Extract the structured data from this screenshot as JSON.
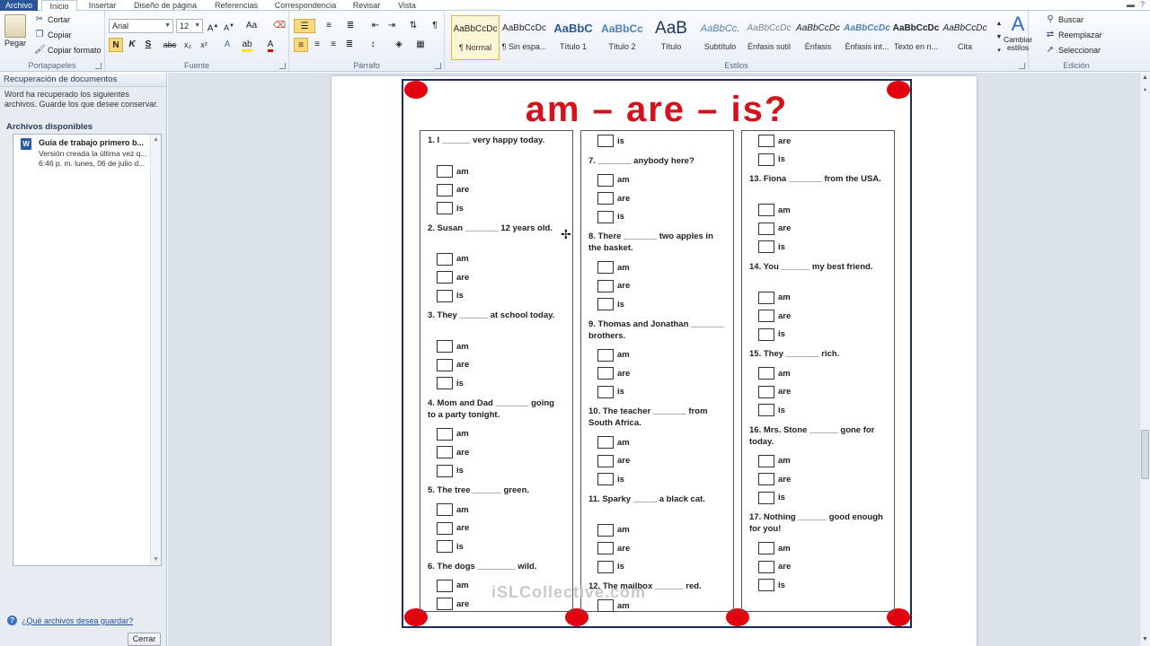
{
  "tabs": [
    "Archivo",
    "Inicio",
    "Insertar",
    "Diseño de página",
    "Referencias",
    "Correspondencia",
    "Revisar",
    "Vista"
  ],
  "clipboard": {
    "paste": "Pegar",
    "cut": "Cortar",
    "copy": "Copiar",
    "format": "Copiar formato",
    "label": "Portapapeles"
  },
  "font": {
    "name": "Arial",
    "size": "12",
    "bold": "N",
    "italic": "K",
    "underline": "S",
    "label": "Fuente"
  },
  "paragraph": {
    "label": "Párrafo"
  },
  "styles": {
    "label": "Estilos",
    "items": [
      {
        "sample": "AaBbCcDc",
        "name": "¶ Normal"
      },
      {
        "sample": "AaBbCcDc",
        "name": "¶ Sin espa..."
      },
      {
        "sample": "AaBbC",
        "name": "Título 1"
      },
      {
        "sample": "AaBbCc",
        "name": "Título 2"
      },
      {
        "sample": "AaB",
        "name": "Título"
      },
      {
        "sample": "AaBbCc.",
        "name": "Subtítulo"
      },
      {
        "sample": "AaBbCcDc",
        "name": "Énfasis sutil"
      },
      {
        "sample": "AaBbCcDc",
        "name": "Énfasis"
      },
      {
        "sample": "AaBbCcDc",
        "name": "Énfasis int..."
      },
      {
        "sample": "AaBbCcDc",
        "name": "Texto en n..."
      },
      {
        "sample": "AaBbCcDc",
        "name": "Cita"
      }
    ],
    "change": "Cambiar estilos"
  },
  "editing": {
    "find": "Buscar",
    "replace": "Reemplazar",
    "select": "Seleccionar",
    "label": "Edición"
  },
  "recovery": {
    "title": "Recuperación de documentos",
    "desc": "Word ha recuperado los siguientes archivos. Guarde los que desee conservar.",
    "available": "Archivos disponibles",
    "file_name": "Guía de trabajo primero b...",
    "file_line1": "Versión creada la última vez q...",
    "file_line2": "6:46 p. m. lunes, 06 de julio d...",
    "help": "¿Qué archivos desea guardar?",
    "close": "Cerrar"
  },
  "worksheet": {
    "title": "am – are – is?",
    "watermark": "iSLCollective.com",
    "col1": [
      {
        "q": "1. I ______ very happy today.",
        "opts": [
          "am",
          "are",
          "is"
        ]
      },
      {
        "q": "2. Susan _______ 12 years old.",
        "opts": [
          "am",
          "are",
          "is"
        ]
      },
      {
        "q": "3. They ______ at school today.",
        "opts": [
          "am",
          "are",
          "is"
        ]
      },
      {
        "q": "4. Mom and Dad _______ going to a party tonight.",
        "opts": [
          "am",
          "are",
          "is"
        ]
      },
      {
        "q": "5. The tree ______ green.",
        "opts": [
          "am",
          "are",
          "is"
        ]
      },
      {
        "q": "6. The dogs ________ wild.",
        "opts": [
          "am",
          "are"
        ]
      }
    ],
    "col2": [
      {
        "q": "",
        "opts": [
          "is"
        ]
      },
      {
        "q": "7. _______ anybody here?",
        "opts": [
          "am",
          "are",
          "is"
        ]
      },
      {
        "q": "8. There _______ two apples in the basket.",
        "opts": [
          "am",
          "are",
          "is"
        ]
      },
      {
        "q": "9. Thomas and Jonathan _______ brothers.",
        "opts": [
          "am",
          "are",
          "is"
        ]
      },
      {
        "q": "10. The teacher _______ from South Africa.",
        "opts": [
          "am",
          "are",
          "is"
        ]
      },
      {
        "q": "11. Sparky _____ a black cat.",
        "opts": [
          "am",
          "are",
          "is"
        ]
      },
      {
        "q": "12. The mailbox ______ red.",
        "opts": [
          "am"
        ]
      }
    ],
    "col3": [
      {
        "q": "",
        "opts": [
          "are",
          "is"
        ]
      },
      {
        "q": "13. Fiona _______ from the USA.",
        "opts": [
          "am",
          "are",
          "is"
        ]
      },
      {
        "q": "14. You ______ my best friend.",
        "opts": [
          "am",
          "are",
          "is"
        ]
      },
      {
        "q": "15. They _______ rich.",
        "opts": [
          "am",
          "are",
          "is"
        ]
      },
      {
        "q": "16. Mrs. Stone ______ gone for today.",
        "opts": [
          "am",
          "are",
          "is"
        ]
      },
      {
        "q": "17. Nothing ______ good enough for you!",
        "opts": [
          "am",
          "are",
          "is"
        ]
      }
    ]
  }
}
